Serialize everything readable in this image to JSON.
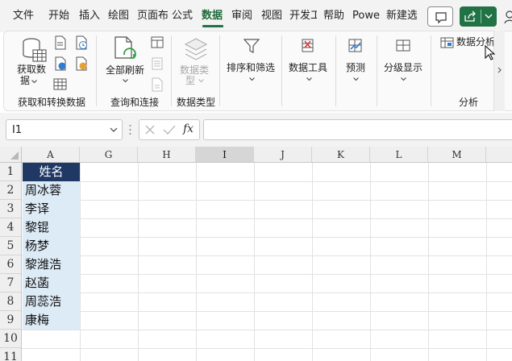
{
  "ribbon_tabs": [
    {
      "label": "文件"
    },
    {
      "label": "开始"
    },
    {
      "label": "插入"
    },
    {
      "label": "绘图"
    },
    {
      "label": "页面布"
    },
    {
      "label": "公式"
    },
    {
      "label": "数据"
    },
    {
      "label": "审阅"
    },
    {
      "label": "视图"
    },
    {
      "label": "开发工"
    },
    {
      "label": "帮助"
    },
    {
      "label": "Powe"
    },
    {
      "label": "新建选"
    }
  ],
  "active_tab": "数据",
  "ribbon": {
    "get_data": {
      "line1": "获取数",
      "line2": "据"
    },
    "refresh_all": "全部刷新",
    "data_types": {
      "line1": "数据类",
      "line2": "型"
    },
    "sort_filter": "排序和筛选",
    "data_tools": "数据工具",
    "forecast": "预测",
    "outline": "分级显示",
    "data_analysis": "数据分析",
    "groups": {
      "get_transform": "获取和转换数据",
      "queries": "查询和连接",
      "data_types": "数据类型",
      "analysis": "分析"
    }
  },
  "formula_bar": {
    "name_box": "I1",
    "fx": "fx",
    "formula": ""
  },
  "columns": [
    "A",
    "G",
    "H",
    "I",
    "J",
    "K",
    "L",
    "M"
  ],
  "selected_column": "I",
  "rows": [
    "1",
    "2",
    "3",
    "4",
    "5",
    "6",
    "7",
    "8",
    "9",
    "10",
    "11"
  ],
  "sheet": {
    "header": "姓名",
    "names": [
      "周冰蓉",
      "李译",
      "黎锟",
      "杨梦",
      "黎潍浩",
      "赵菡",
      "周蕊浩",
      "康梅"
    ]
  },
  "colors": {
    "accent": "#217346",
    "header_fill": "#203864",
    "data_fill": "#ddebf7"
  }
}
